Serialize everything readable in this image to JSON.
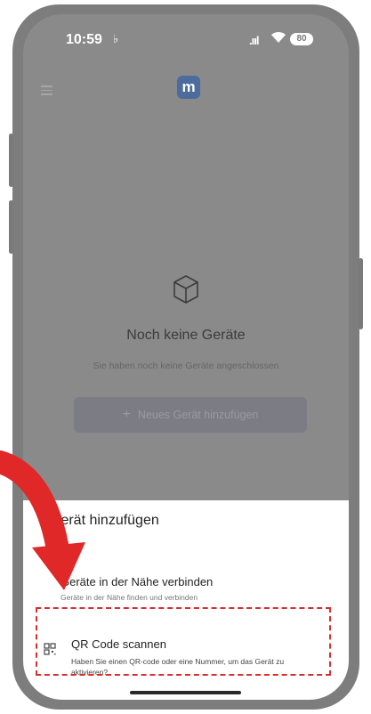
{
  "status_bar": {
    "time": "10:59",
    "signal": ".ııl",
    "battery": "80"
  },
  "header": {
    "logo_letter": "m"
  },
  "empty_state": {
    "title": "Noch keine Geräte",
    "subtitle": "Sie haben noch keine Geräte angeschlossen",
    "add_button_label": "Neues Gerät hinzufügen"
  },
  "sheet": {
    "title": "Gerät hinzufügen",
    "options": [
      {
        "title": "Geräte in der Nähe verbinden",
        "subtitle": "Geräte in der Nähe finden und verbinden"
      },
      {
        "title": "QR Code scannen",
        "subtitle": "Haben Sie einen QR-code oder eine Nummer, um das Gerät zu aktivieren?"
      }
    ]
  },
  "icons": [
    "bell-icon",
    "wifi-icon",
    "menu-icon",
    "cube-icon",
    "plus-icon",
    "qr-icon",
    "red-arrow"
  ],
  "colors": {
    "highlight": "#d92d2f",
    "logo": "#4b6c9c",
    "overlay": "#8a8a8a"
  }
}
